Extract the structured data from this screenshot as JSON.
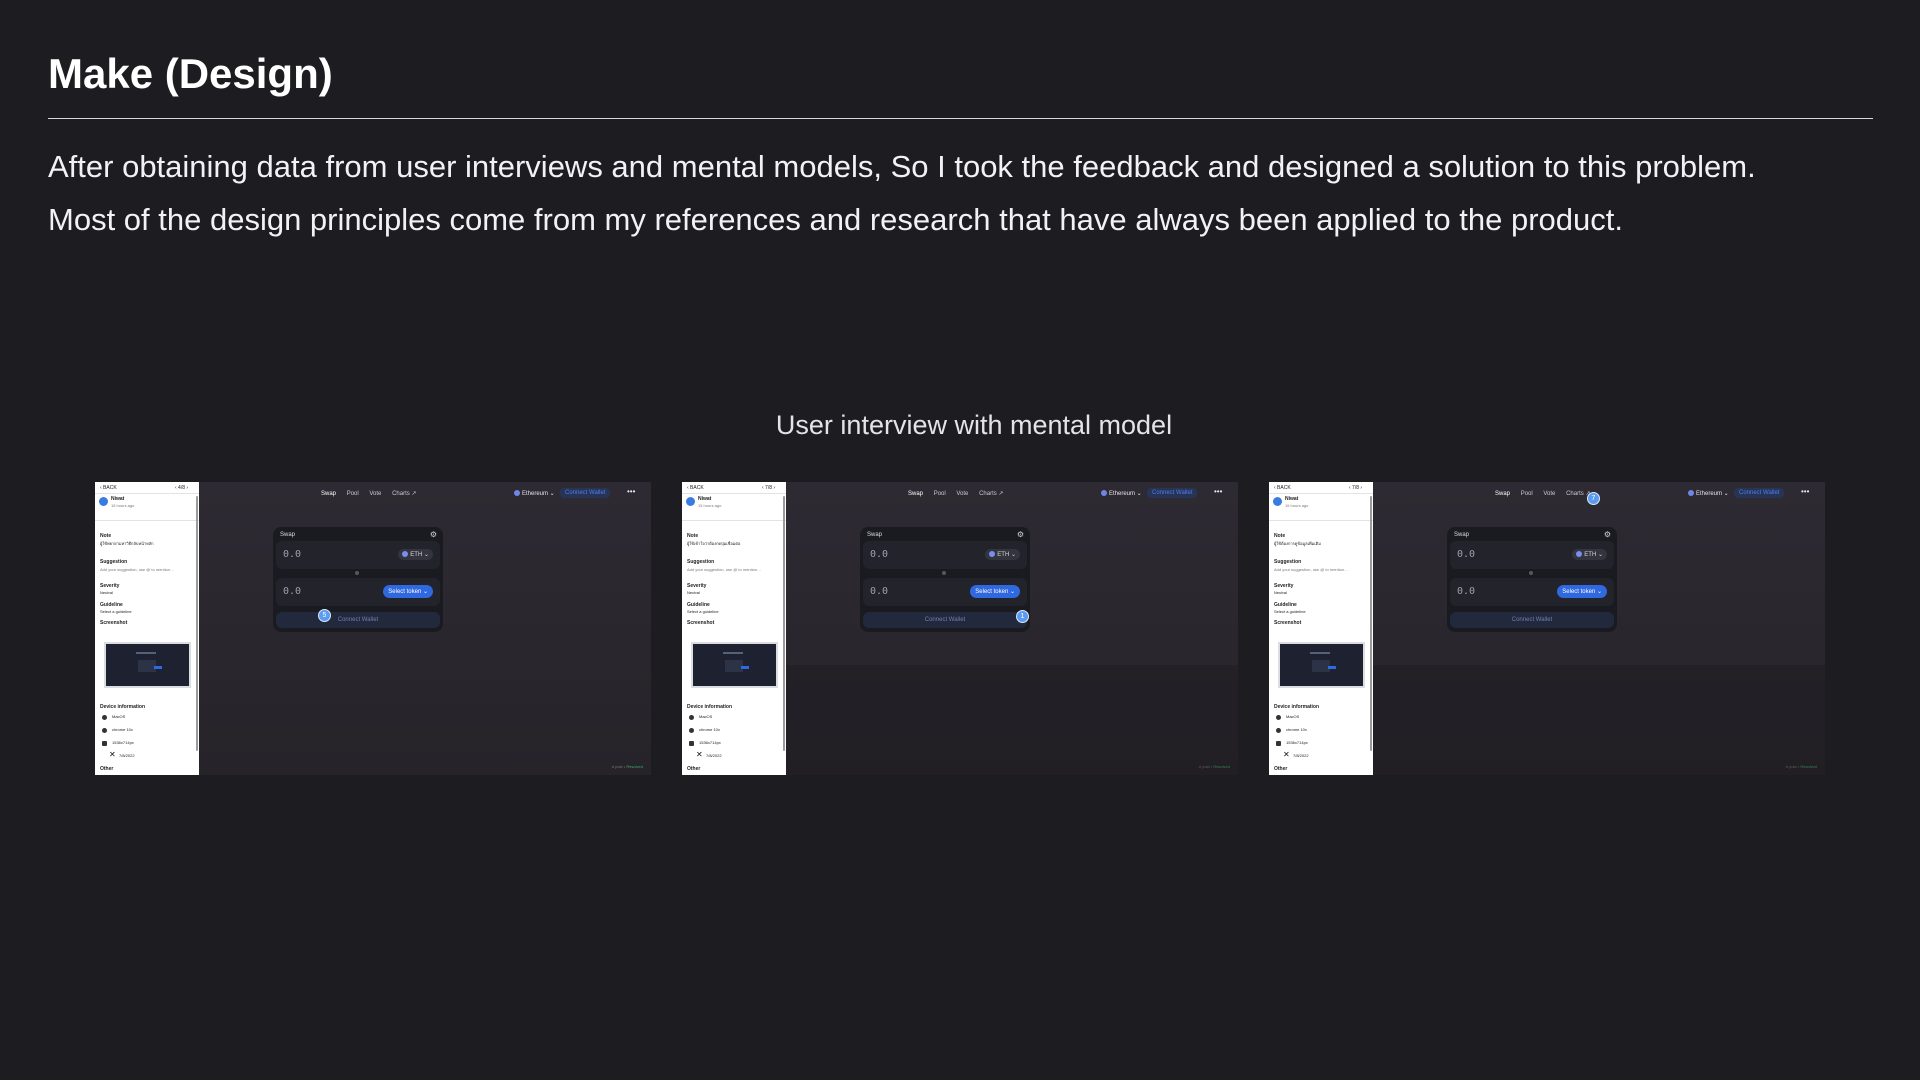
{
  "page": {
    "title": "Make (Design)",
    "paragraph_lines": [
      "After obtaining data from user interviews and mental models, So I took the feedback and designed a solution to this problem.",
      "Most of the design principles come from my references and research that have always been applied to the product."
    ],
    "caption": "User interview with mental model"
  },
  "screenshots": [
    {
      "panel": {
        "back": "‹ BACK",
        "pager": "‹ 4/8 ›",
        "user": "Niwat",
        "time": "15 hours ago",
        "note_label": "Note",
        "note_text": "ผู้ใช้พยายามหาวิธีกลับหน้าหลัก",
        "suggestion_label": "Suggestion",
        "suggestion_placeholder": "Add your suggestion, use @ to mention…",
        "severity_label": "Severity",
        "severity_value": "Neutral",
        "guideline_label": "Guideline",
        "guideline_value": "Select a guideline",
        "screenshot_label": "Screenshot",
        "device_label": "Device information",
        "device_os": "MacOS",
        "device_browser": "chrome 10x",
        "device_res": "1536x714px",
        "device_date": "7/8/2022",
        "other_label": "Other"
      },
      "marker": "5"
    },
    {
      "panel": {
        "back": "‹ BACK",
        "pager": "‹ 7/8 ›",
        "user": "Niwat",
        "time": "15 hours ago",
        "note_label": "Note",
        "note_text": "ผู้ใช้เข้าใจว่าต้องกดปุ่มเชื่อมต่อ",
        "suggestion_label": "Suggestion",
        "suggestion_placeholder": "Add your suggestion, use @ to mention…",
        "severity_label": "Severity",
        "severity_value": "Neutral",
        "guideline_label": "Guideline",
        "guideline_value": "Select a guideline",
        "screenshot_label": "Screenshot",
        "device_label": "Device information",
        "device_os": "MacOS",
        "device_browser": "chrome 10x",
        "device_res": "1536x714px",
        "device_date": "7/8/2022",
        "other_label": "Other"
      },
      "marker": "1"
    },
    {
      "panel": {
        "back": "‹ BACK",
        "pager": "‹ 7/8 ›",
        "user": "Niwat",
        "time": "15 hours ago",
        "note_label": "Note",
        "note_text": "ผู้ใช้ต้องการดูข้อมูลเพิ่มเติม",
        "suggestion_label": "Suggestion",
        "suggestion_placeholder": "Add your suggestion, use @ to mention…",
        "severity_label": "Severity",
        "severity_value": "Neutral",
        "guideline_label": "Guideline",
        "guideline_value": "Select a guideline",
        "screenshot_label": "Screenshot",
        "device_label": "Device information",
        "device_os": "MacOS",
        "device_browser": "chrome 10x",
        "device_res": "1536x714px",
        "device_date": "7/8/2022",
        "other_label": "Other"
      },
      "marker": "7"
    }
  ],
  "app": {
    "nav": [
      "Swap",
      "Pool",
      "Vote",
      "Charts ↗"
    ],
    "network": "Ethereum ⌄",
    "connect_wallet": "Connect Wallet",
    "more": "•••",
    "swap_label": "Swap",
    "gear": "⚙",
    "input_value": "0.0",
    "token": "ETH ⌄",
    "select_token": "Select token ⌄",
    "connect_button": "Connect Wallet",
    "footer": "# post •",
    "footer_status": "Resolved"
  },
  "colors": {
    "background": "#1c1c21",
    "accent": "#3068e0",
    "marker": "#5b9cf0"
  },
  "icons": [
    "shield-icon",
    "gear-icon",
    "close-icon",
    "chevron-down-icon",
    "eth-icon"
  ]
}
